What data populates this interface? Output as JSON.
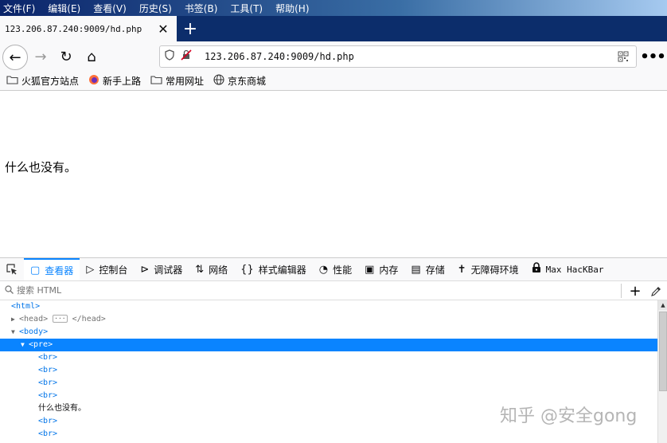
{
  "menubar": {
    "items": [
      "文件(F)",
      "编辑(E)",
      "查看(V)",
      "历史(S)",
      "书签(B)",
      "工具(T)",
      "帮助(H)"
    ]
  },
  "tab": {
    "title": "123.206.87.240:9009/hd.php",
    "close_glyph": "✕"
  },
  "newtab_glyph": "+",
  "nav": {
    "back_glyph": "←",
    "forward_glyph": "→",
    "reload_glyph": "↻",
    "home_glyph": "⌂",
    "url": "123.206.87.240:9009/hd.php",
    "menu_glyph": "•••"
  },
  "bookmarks": [
    {
      "label": "火狐官方站点",
      "icon": "folder-icon"
    },
    {
      "label": "新手上路",
      "icon": "firefox-icon"
    },
    {
      "label": "常用网址",
      "icon": "folder-icon"
    },
    {
      "label": "京东商城",
      "icon": "globe-icon"
    }
  ],
  "page": {
    "body_text": "什么也没有。"
  },
  "devtools": {
    "tabs": [
      {
        "label": "查看器",
        "icon": "inspector-icon",
        "glyph": "▢"
      },
      {
        "label": "控制台",
        "icon": "console-icon",
        "glyph": "▷"
      },
      {
        "label": "调试器",
        "icon": "debugger-icon",
        "glyph": "⊳"
      },
      {
        "label": "网络",
        "icon": "network-icon",
        "glyph": "⇅"
      },
      {
        "label": "样式编辑器",
        "icon": "style-editor-icon",
        "glyph": "{}"
      },
      {
        "label": "性能",
        "icon": "performance-icon",
        "glyph": "◔"
      },
      {
        "label": "内存",
        "icon": "memory-icon",
        "glyph": "▣"
      },
      {
        "label": "存储",
        "icon": "storage-icon",
        "glyph": "▤"
      },
      {
        "label": "无障碍环境",
        "icon": "accessibility-icon",
        "glyph": "✝"
      },
      {
        "label": "Max HacKBar",
        "icon": "hackbar-lock-icon",
        "glyph": "🔒"
      }
    ],
    "search_placeholder": "搜索 HTML",
    "plus_glyph": "+",
    "tree": {
      "html": "<html>",
      "head_open": "<head>",
      "head_close": "</head>",
      "head_badge": "···",
      "body": "<body>",
      "pre": "<pre>",
      "br": "<br>",
      "text": "什么也没有。"
    }
  },
  "watermark": "知乎 @安全gong"
}
